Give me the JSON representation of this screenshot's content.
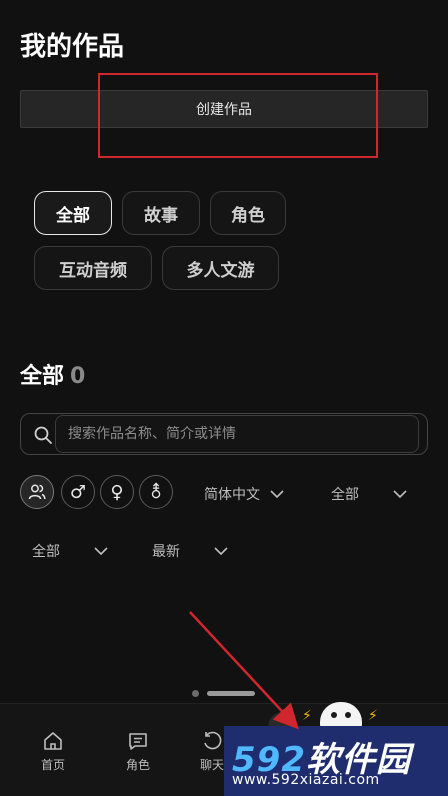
{
  "header": {
    "title": "我的作品"
  },
  "create_button": {
    "label": "创建作品"
  },
  "categories": [
    {
      "label": "全部",
      "active": true
    },
    {
      "label": "故事",
      "active": false
    },
    {
      "label": "角色",
      "active": false
    },
    {
      "label": "互动音频",
      "active": false
    },
    {
      "label": "多人文游",
      "active": false
    }
  ],
  "section": {
    "title": "全部",
    "count": "0"
  },
  "search": {
    "placeholder": "搜索作品名称、简介或详情"
  },
  "gender_filters": [
    {
      "icon": "users-icon",
      "glyph": "",
      "active": true
    },
    {
      "icon": "male-icon",
      "glyph": "♂",
      "active": false
    },
    {
      "icon": "female-icon",
      "glyph": "♀",
      "active": false
    },
    {
      "icon": "nonbinary-icon",
      "glyph": "⚨",
      "active": false
    }
  ],
  "filters": {
    "language": "简体中文",
    "scope": "全部",
    "status": "全部",
    "sort": "最新"
  },
  "tabbar": {
    "items": [
      {
        "label": "首页",
        "icon": "home-icon"
      },
      {
        "label": "角色",
        "icon": "chat-icon"
      },
      {
        "label": "聊天",
        "icon": "refresh-icon"
      }
    ]
  },
  "watermark": {
    "brand_num": "592",
    "brand_text": "软件园",
    "url": "www.592xiazai.com"
  },
  "colors": {
    "background": "#111111",
    "annotation_red": "#d0262e",
    "watermark_bg": "#1f2c6e"
  }
}
